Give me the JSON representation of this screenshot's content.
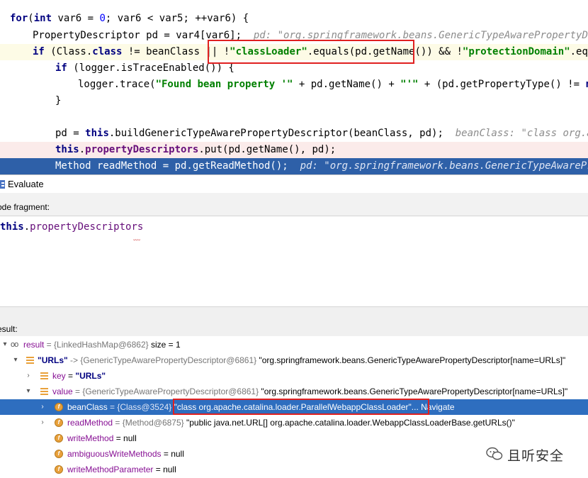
{
  "editor": {
    "lines": [
      {
        "parts": [
          {
            "t": "for",
            "c": "kw"
          },
          {
            "t": "(",
            "c": ""
          },
          {
            "t": "int",
            "c": "kw"
          },
          {
            "t": " var6 = ",
            "c": ""
          },
          {
            "t": "0",
            "c": "num"
          },
          {
            "t": "; var6 < var5; ++var6) {",
            "c": ""
          }
        ]
      },
      {
        "parts": [
          {
            "t": "PropertyDescriptor pd = var4[var6];",
            "c": ""
          },
          {
            "t": "  pd: \"org.springframework.beans.GenericTypeAwarePropertyDescri",
            "c": "inl"
          }
        ]
      },
      {
        "parts": [
          {
            "t": "if",
            "c": "kw"
          },
          {
            "t": " (Class.",
            "c": ""
          },
          {
            "t": "class",
            "c": "kw"
          },
          {
            "t": " != beanClass || !",
            "c": ""
          },
          {
            "t": "\"classLoader\"",
            "c": "str"
          },
          {
            "t": ".equals(pd.getName()) && !",
            "c": ""
          },
          {
            "t": "\"protectionDomain\"",
            "c": "str"
          },
          {
            "t": ".equals(",
            "c": ""
          }
        ]
      },
      {
        "parts": [
          {
            "t": "if",
            "c": "kw"
          },
          {
            "t": " (logger.isTraceEnabled()) {",
            "c": ""
          }
        ]
      },
      {
        "parts": [
          {
            "t": "logger.trace(",
            "c": ""
          },
          {
            "t": "\"Found bean property '\"",
            "c": "str"
          },
          {
            "t": " + pd.getName() + ",
            "c": ""
          },
          {
            "t": "\"'\"",
            "c": "str"
          },
          {
            "t": " + (pd.getPropertyType() != ",
            "c": ""
          },
          {
            "t": "null",
            "c": "kw"
          }
        ]
      },
      {
        "parts": [
          {
            "t": "}",
            "c": ""
          }
        ]
      },
      {
        "parts": [
          {
            "t": "",
            "c": ""
          }
        ]
      },
      {
        "parts": [
          {
            "t": "pd = ",
            "c": ""
          },
          {
            "t": "this",
            "c": "kw"
          },
          {
            "t": ".buildGenericTypeAwarePropertyDescriptor(beanClass, pd);",
            "c": ""
          },
          {
            "t": "  beanClass: \"class org.apach",
            "c": "inl"
          }
        ]
      },
      {
        "parts": [
          {
            "t": "this",
            "c": "kw"
          },
          {
            "t": ".",
            "c": ""
          },
          {
            "t": "propertyDescriptors",
            "c": "fld"
          },
          {
            "t": ".put(pd.getName(), pd);",
            "c": ""
          }
        ]
      },
      {
        "parts": [
          {
            "t": "Method readMethod = pd.getReadMethod();",
            "c": ""
          },
          {
            "t": "  pd: \"org.springframework.beans.GenericTypeAwareProper",
            "c": "inl-white"
          }
        ]
      }
    ]
  },
  "evaluate": {
    "title": "Evaluate",
    "fragment_label": "ode fragment:",
    "fragment_kw": "this",
    "fragment_dot": ".",
    "fragment_field": "propertyDescriptors",
    "result_label": "esult:"
  },
  "tree": {
    "rows": [
      {
        "name": "result",
        "rest": " = {LinkedHashMap@6862}",
        "extra": "  size = 1"
      },
      {
        "name": "\"URLs\"",
        "rest": " -> {GenericTypeAwarePropertyDescriptor@6861}",
        "extra": " \"org.springframework.beans.GenericTypeAwarePropertyDescriptor[name=URLs]\""
      },
      {
        "name": "key",
        "rest": " = ",
        "extra": "\"URLs\""
      },
      {
        "name": "value",
        "rest": " = {GenericTypeAwarePropertyDescriptor@6861}",
        "extra": " \"org.springframework.beans.GenericTypeAwarePropertyDescriptor[name=URLs]\""
      },
      {
        "name": "beanClass",
        "rest": " = {Class@3524}",
        "extra": " \"class org.apache.catalina.loader.ParallelWebappClassLoader\"",
        "link": "... Navigate"
      },
      {
        "name": "readMethod",
        "rest": " = {Method@6875}",
        "extra": " \"public java.net.URL[] org.apache.catalina.loader.WebappClassLoaderBase.getURLs()\""
      },
      {
        "name": "writeMethod",
        "rest": " = null",
        "extra": ""
      },
      {
        "name": "ambiguousWriteMethods",
        "rest": " = null",
        "extra": ""
      },
      {
        "name": "writeMethodParameter",
        "rest": " = null",
        "extra": ""
      }
    ]
  },
  "watermark": {
    "text": "且听安全",
    "icon": "wechat-icon"
  },
  "colors": {
    "execution_line": "#2e60a8",
    "selection": "#2e6ebf",
    "highlight_box": "#e02020"
  }
}
